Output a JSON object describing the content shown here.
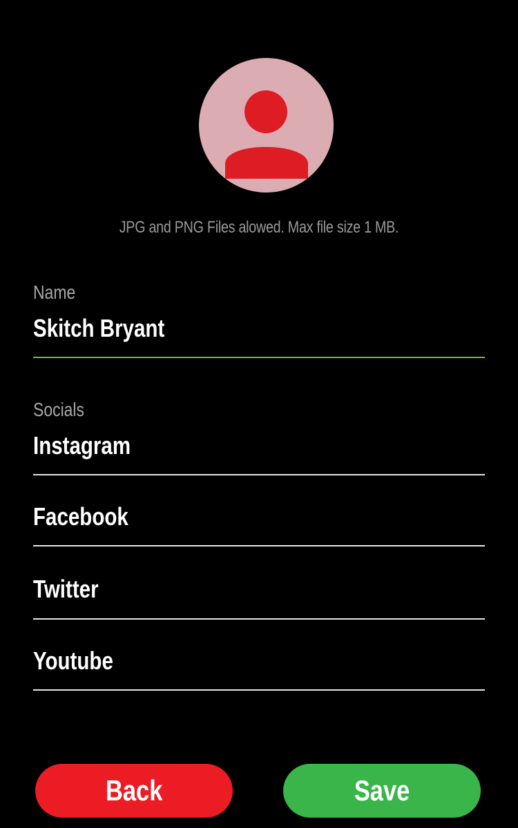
{
  "avatar": {
    "icon": "user-silhouette-icon",
    "background_color": "#dcacb3",
    "figure_color": "#dd1c24"
  },
  "upload_hint": "JPG and PNG Files alowed. Max file size 1 MB.",
  "name_section": {
    "label": "Name",
    "value": "Skitch Bryant",
    "active_underline_color": "#6cbf3e"
  },
  "socials_section": {
    "label": "Socials",
    "fields": [
      {
        "placeholder": "Instagram",
        "value": ""
      },
      {
        "placeholder": "Facebook",
        "value": ""
      },
      {
        "placeholder": "Twitter",
        "value": ""
      },
      {
        "placeholder": "Youtube",
        "value": ""
      }
    ]
  },
  "buttons": {
    "back_label": "Back",
    "back_color": "#ec1c24",
    "save_label": "Save",
    "save_color": "#39b54a"
  }
}
